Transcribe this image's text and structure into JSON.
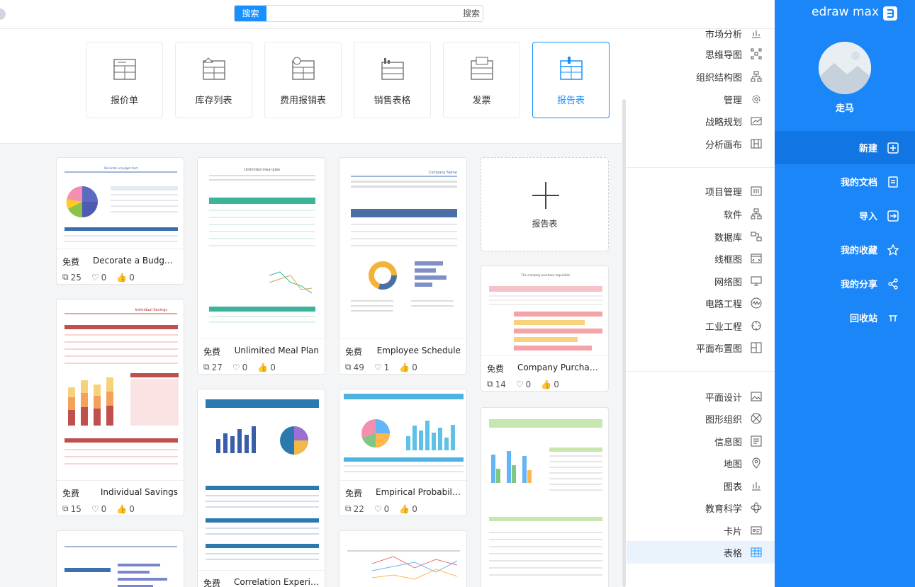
{
  "app": {
    "logo_text": "edraw max",
    "username": "走马"
  },
  "search": {
    "button_label": "搜索",
    "placeholder": "搜索"
  },
  "categories": [
    {
      "label": "报告表",
      "active": true
    },
    {
      "label": "发票",
      "active": false
    },
    {
      "label": "销售表格",
      "active": false
    },
    {
      "label": "费用报销表",
      "active": false
    },
    {
      "label": "库存列表",
      "active": false
    },
    {
      "label": "报价单",
      "active": false
    }
  ],
  "add_card": {
    "label": "报告表"
  },
  "templates": [
    {
      "title": "Employee Schedule",
      "tag": "免费",
      "likes": "0",
      "favs": "1",
      "copies": "49"
    },
    {
      "title": "Unlimited Meal Plan",
      "tag": "免费",
      "likes": "0",
      "favs": "0",
      "copies": "27"
    },
    {
      "title": "Decorate a Budget F...",
      "tag": "免费",
      "likes": "0",
      "favs": "0",
      "copies": "25"
    },
    {
      "title": "Company Purchase R...",
      "tag": "免费",
      "likes": "0",
      "favs": "0",
      "copies": "14"
    },
    {
      "title": "Empirical Probability",
      "tag": "免费",
      "likes": "0",
      "favs": "0",
      "copies": "22"
    },
    {
      "title": "Individual Savings",
      "tag": "免费",
      "likes": "0",
      "favs": "0",
      "copies": "15"
    },
    {
      "title": "Correlation Experim...",
      "tag": "免费"
    }
  ],
  "menu": {
    "group1": [
      "市场分析",
      "思维导图",
      "组织结构图",
      "管理",
      "战略规划",
      "分析画布"
    ],
    "group2": [
      "项目管理",
      "软件",
      "数据库",
      "线框图",
      "网络图",
      "电路工程",
      "工业工程",
      "平面布置图"
    ],
    "group3": [
      "平面设计",
      "图形组织",
      "信息图",
      "地图",
      "图表",
      "教育科学",
      "卡片",
      "表格"
    ],
    "selected": "表格"
  },
  "sidebar": {
    "items": [
      {
        "label": "新建",
        "icon": "new-icon"
      },
      {
        "label": "我的文档",
        "icon": "document-icon"
      },
      {
        "label": "导入",
        "icon": "import-icon"
      },
      {
        "label": "我的收藏",
        "icon": "star-icon"
      },
      {
        "label": "我的分享",
        "icon": "share-icon"
      },
      {
        "label": "回收站",
        "icon": "trash-icon"
      }
    ],
    "selected": "新建"
  },
  "colors": {
    "brand": "#1a86f7",
    "brand_dark": "#1175e4",
    "accent": "#1890ff"
  }
}
